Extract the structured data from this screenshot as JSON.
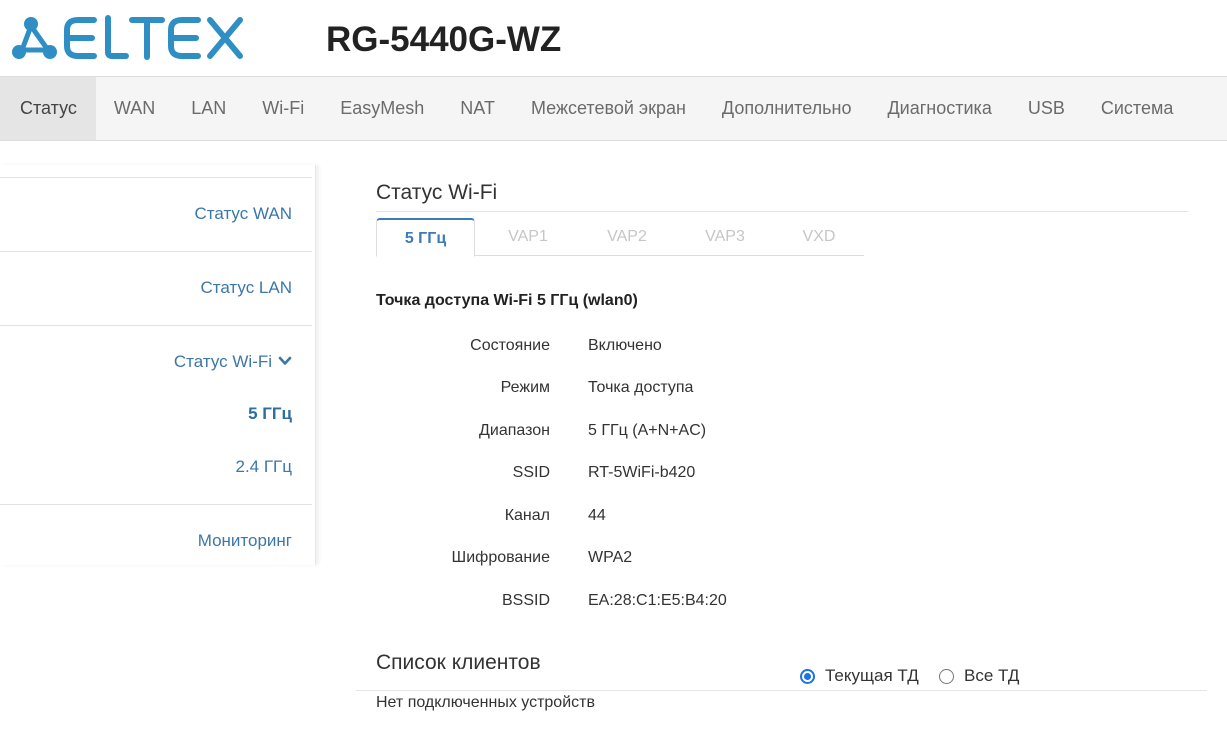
{
  "header": {
    "logo_text": "ELTEX",
    "model": "RG-5440G-WZ",
    "brand_color": "#2f8fc4"
  },
  "nav": {
    "items": [
      {
        "label": "Статус",
        "active": true
      },
      {
        "label": "WAN"
      },
      {
        "label": "LAN"
      },
      {
        "label": "Wi-Fi"
      },
      {
        "label": "EasyMesh"
      },
      {
        "label": "NAT"
      },
      {
        "label": "Межсетевой экран"
      },
      {
        "label": "Дополнительно"
      },
      {
        "label": "Диагностика"
      },
      {
        "label": "USB"
      },
      {
        "label": "Система"
      }
    ]
  },
  "sidebar": {
    "items": [
      {
        "label": "Статус WAN"
      },
      {
        "label": "Статус LAN"
      },
      {
        "label": "Статус Wi-Fi",
        "icon": "chevron-down-icon",
        "expanded": true
      },
      {
        "label": "5 ГГц",
        "active": true
      },
      {
        "label": "2.4 ГГц"
      },
      {
        "label": "Мониторинг"
      }
    ]
  },
  "wifi_status": {
    "title": "Статус Wi-Fi",
    "tabs": [
      {
        "label": "5 ГГц",
        "active": true
      },
      {
        "label": "VAP1"
      },
      {
        "label": "VAP2"
      },
      {
        "label": "VAP3"
      },
      {
        "label": "VXD"
      }
    ],
    "ap_title": "Точка доступа Wi-Fi 5 ГГц (wlan0)",
    "rows": [
      {
        "label": "Состояние",
        "value": "Включено"
      },
      {
        "label": "Режим",
        "value": "Точка доступа"
      },
      {
        "label": "Диапазон",
        "value": "5 ГГц (A+N+AC)"
      },
      {
        "label": "SSID",
        "value": "RT-5WiFi-b420"
      },
      {
        "label": "Канал",
        "value": "44"
      },
      {
        "label": "Шифрование",
        "value": "WPA2"
      },
      {
        "label": "BSSID",
        "value": "EA:28:C1:E5:B4:20"
      }
    ]
  },
  "clients": {
    "title": "Список клиентов",
    "radio_current": {
      "label": "Текущая ТД",
      "checked": true
    },
    "radio_all": {
      "label": "Все ТД",
      "checked": false
    },
    "empty_text": "Нет подключенных устройств"
  },
  "colors": {
    "link": "#3b77a9",
    "accent": "#3d7ab8",
    "radio": "#1a73e8"
  }
}
